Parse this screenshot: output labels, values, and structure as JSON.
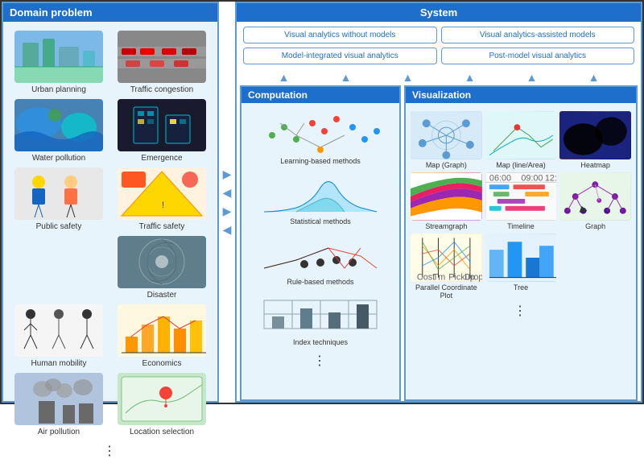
{
  "domainPanel": {
    "header": "Domain problem",
    "items": [
      {
        "label": "Urban planning",
        "imgClass": "img-urban"
      },
      {
        "label": "Traffic congestion",
        "imgClass": "img-traffic"
      },
      {
        "label": "Water pollution",
        "imgClass": "img-water"
      },
      {
        "label": "Emergence",
        "imgClass": "img-emergence"
      },
      {
        "label": "Public safety",
        "imgClass": "img-safety"
      },
      {
        "label": "Traffic safety",
        "imgClass": "img-traffic-safety"
      },
      {
        "label": "Disaster",
        "imgClass": "img-disaster"
      },
      {
        "label": "Human mobility",
        "imgClass": "img-mobility"
      },
      {
        "label": "Economics",
        "imgClass": "img-economics"
      },
      {
        "label": "Air pollution",
        "imgClass": "img-air"
      },
      {
        "label": "Location selection",
        "imgClass": "img-location"
      }
    ],
    "dots": "⋮"
  },
  "systemPanel": {
    "header": "System",
    "buttons": [
      "Visual analytics without models",
      "Visual analytics-assisted models",
      "Model-integrated visual analytics",
      "Post-model visual analytics"
    ]
  },
  "computationPanel": {
    "header": "Computation",
    "items": [
      {
        "label": "Learning-based methods"
      },
      {
        "label": "Statistical methods"
      },
      {
        "label": "Rule-based methods"
      },
      {
        "label": "Index techniques"
      }
    ],
    "dots": "⋮"
  },
  "vizPanel": {
    "header": "Visualization",
    "items": [
      {
        "label": "Map (Graph)",
        "imgClass": "viz-img-graph"
      },
      {
        "label": "Map (line/Area)",
        "imgClass": "viz-img-mapline"
      },
      {
        "label": "Heatmap",
        "imgClass": "viz-img-heatmap"
      },
      {
        "label": "Streamgraph",
        "imgClass": "viz-img-stream"
      },
      {
        "label": "Timeline",
        "imgClass": "viz-img-timeline"
      },
      {
        "label": "Graph",
        "imgClass": "viz-img-graph2"
      },
      {
        "label": "Parallel Coordinate Plot",
        "imgClass": "viz-img-parallel"
      },
      {
        "label": "Tree",
        "imgClass": "viz-img-tree"
      }
    ],
    "dots": "⋮"
  },
  "arrows": {
    "up": "▲",
    "right": "▶",
    "left": "◀"
  }
}
